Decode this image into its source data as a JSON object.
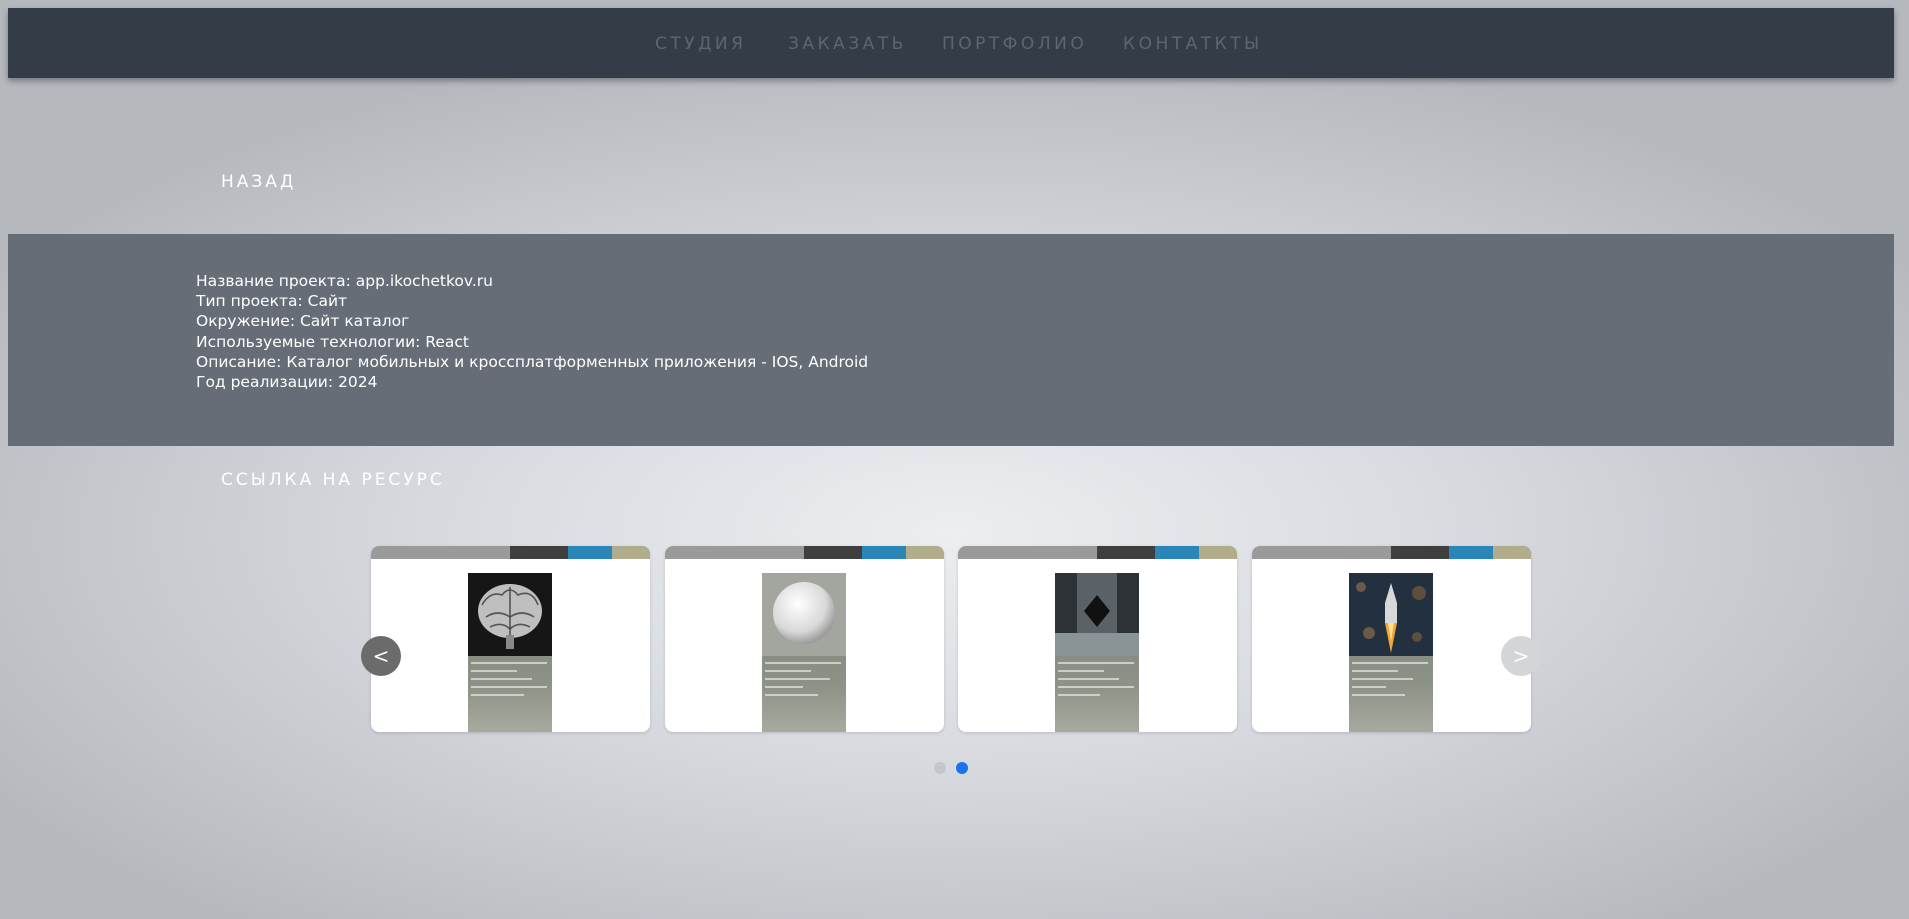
{
  "nav": {
    "items": [
      "СТУДИЯ",
      "ЗАКАЗАТЬ",
      "ПОРТФОЛИО",
      "КОНТАТКТЫ"
    ]
  },
  "back_label": "НАЗАД",
  "project_info": [
    "Название проекта: app.ikochetkov.ru",
    "Тип проекта: Сайт",
    "Окружение: Сайт каталог",
    "Используемые технологии: React",
    "Описание: Каталог мобильных и кроссплатформенных приложения - IOS, Android",
    "Год реализации: 2024"
  ],
  "resource_label": "ССЫЛКА НА РЕСУРС",
  "carousel": {
    "prev_label": "<",
    "next_label": ">",
    "active_dot": 1,
    "colors": {
      "dot_active": "#1a73e8",
      "dot_inactive": "#c4c6c9"
    },
    "slides": [
      {
        "image": "brain-image",
        "colors": {
          "bg": "#2a2a2a"
        }
      },
      {
        "image": "sphere-image",
        "colors": {
          "bg": "#9a9d98"
        }
      },
      {
        "image": "monolith-image",
        "colors": {
          "bg": "#3d4347"
        }
      },
      {
        "image": "rocket-image",
        "colors": {
          "bg": "#2b3a4c"
        }
      }
    ]
  },
  "colors": {
    "navbar": "#343d47",
    "nav_text": "#5d6670",
    "info_panel": "#676d76"
  }
}
